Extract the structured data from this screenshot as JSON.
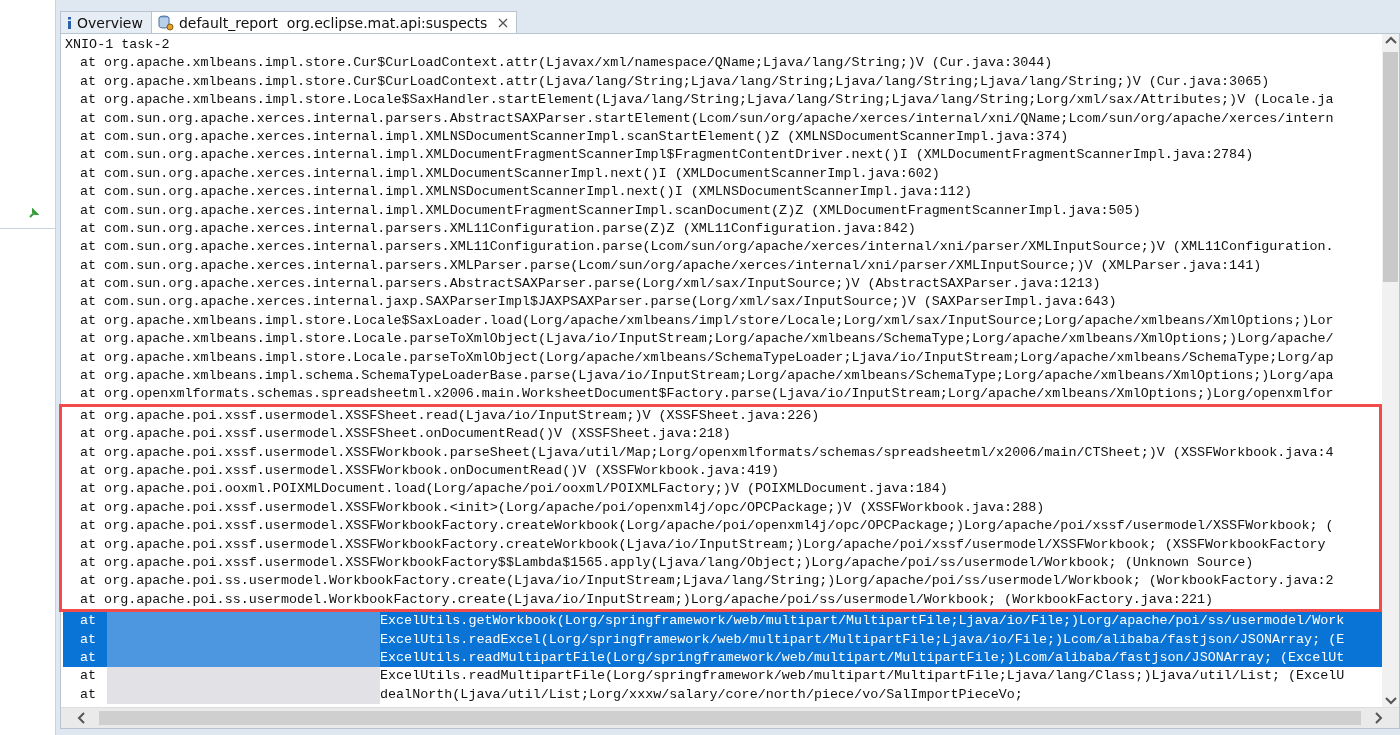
{
  "tabs": [
    {
      "kind": "info",
      "label": "Overview",
      "selected": false,
      "closable": false
    },
    {
      "kind": "report",
      "label": "default_report  org.eclipse.mat.api:suspects",
      "selected": true,
      "closable": true
    }
  ],
  "thread": "XNIO-1 task-2",
  "frames": [
    "at org.apache.xmlbeans.impl.store.Cur$CurLoadContext.attr(Ljavax/xml/namespace/QName;Ljava/lang/String;)V (Cur.java:3044)",
    "at org.apache.xmlbeans.impl.store.Cur$CurLoadContext.attr(Ljava/lang/String;Ljava/lang/String;Ljava/lang/String;Ljava/lang/String;)V (Cur.java:3065)",
    "at org.apache.xmlbeans.impl.store.Locale$SaxHandler.startElement(Ljava/lang/String;Ljava/lang/String;Ljava/lang/String;Lorg/xml/sax/Attributes;)V (Locale.ja",
    "at com.sun.org.apache.xerces.internal.parsers.AbstractSAXParser.startElement(Lcom/sun/org/apache/xerces/internal/xni/QName;Lcom/sun/org/apache/xerces/intern",
    "at com.sun.org.apache.xerces.internal.impl.XMLNSDocumentScannerImpl.scanStartElement()Z (XMLNSDocumentScannerImpl.java:374)",
    "at com.sun.org.apache.xerces.internal.impl.XMLDocumentFragmentScannerImpl$FragmentContentDriver.next()I (XMLDocumentFragmentScannerImpl.java:2784)",
    "at com.sun.org.apache.xerces.internal.impl.XMLDocumentScannerImpl.next()I (XMLDocumentScannerImpl.java:602)",
    "at com.sun.org.apache.xerces.internal.impl.XMLNSDocumentScannerImpl.next()I (XMLNSDocumentScannerImpl.java:112)",
    "at com.sun.org.apache.xerces.internal.impl.XMLDocumentFragmentScannerImpl.scanDocument(Z)Z (XMLDocumentFragmentScannerImpl.java:505)",
    "at com.sun.org.apache.xerces.internal.parsers.XML11Configuration.parse(Z)Z (XML11Configuration.java:842)",
    "at com.sun.org.apache.xerces.internal.parsers.XML11Configuration.parse(Lcom/sun/org/apache/xerces/internal/xni/parser/XMLInputSource;)V (XML11Configuration.",
    "at com.sun.org.apache.xerces.internal.parsers.XMLParser.parse(Lcom/sun/org/apache/xerces/internal/xni/parser/XMLInputSource;)V (XMLParser.java:141)",
    "at com.sun.org.apache.xerces.internal.parsers.AbstractSAXParser.parse(Lorg/xml/sax/InputSource;)V (AbstractSAXParser.java:1213)",
    "at com.sun.org.apache.xerces.internal.jaxp.SAXParserImpl$JAXPSAXParser.parse(Lorg/xml/sax/InputSource;)V (SAXParserImpl.java:643)",
    "at org.apache.xmlbeans.impl.store.Locale$SaxLoader.load(Lorg/apache/xmlbeans/impl/store/Locale;Lorg/xml/sax/InputSource;Lorg/apache/xmlbeans/XmlOptions;)Lor",
    "at org.apache.xmlbeans.impl.store.Locale.parseToXmlObject(Ljava/io/InputStream;Lorg/apache/xmlbeans/SchemaType;Lorg/apache/xmlbeans/XmlOptions;)Lorg/apache/",
    "at org.apache.xmlbeans.impl.store.Locale.parseToXmlObject(Lorg/apache/xmlbeans/SchemaTypeLoader;Ljava/io/InputStream;Lorg/apache/xmlbeans/SchemaType;Lorg/ap",
    "at org.apache.xmlbeans.impl.schema.SchemaTypeLoaderBase.parse(Ljava/io/InputStream;Lorg/apache/xmlbeans/SchemaType;Lorg/apache/xmlbeans/XmlOptions;)Lorg/apa",
    "at org.openxmlformats.schemas.spreadsheetml.x2006.main.WorksheetDocument$Factory.parse(Ljava/io/InputStream;Lorg/apache/xmlbeans/XmlOptions;)Lorg/openxmlfor"
  ],
  "highlighted_frames": [
    "at org.apache.poi.xssf.usermodel.XSSFSheet.read(Ljava/io/InputStream;)V (XSSFSheet.java:226)",
    "at org.apache.poi.xssf.usermodel.XSSFSheet.onDocumentRead()V (XSSFSheet.java:218)",
    "at org.apache.poi.xssf.usermodel.XSSFWorkbook.parseSheet(Ljava/util/Map;Lorg/openxmlformats/schemas/spreadsheetml/x2006/main/CTSheet;)V (XSSFWorkbook.java:4",
    "at org.apache.poi.xssf.usermodel.XSSFWorkbook.onDocumentRead()V (XSSFWorkbook.java:419)",
    "at org.apache.poi.ooxml.POIXMLDocument.load(Lorg/apache/poi/ooxml/POIXMLFactory;)V (POIXMLDocument.java:184)",
    "at org.apache.poi.xssf.usermodel.XSSFWorkbook.<init>(Lorg/apache/poi/openxml4j/opc/OPCPackage;)V (XSSFWorkbook.java:288)",
    "at org.apache.poi.xssf.usermodel.XSSFWorkbookFactory.createWorkbook(Lorg/apache/poi/openxml4j/opc/OPCPackage;)Lorg/apache/poi/xssf/usermodel/XSSFWorkbook; (",
    "at org.apache.poi.xssf.usermodel.XSSFWorkbookFactory.createWorkbook(Ljava/io/InputStream;)Lorg/apache/poi/xssf/usermodel/XSSFWorkbook; (XSSFWorkbookFactory",
    "at org.apache.poi.xssf.usermodel.XSSFWorkbookFactory$$Lambda$1565.apply(Ljava/lang/Object;)Lorg/apache/poi/ss/usermodel/Workbook; (Unknown Source)",
    "at org.apache.poi.ss.usermodel.WorkbookFactory.create(Ljava/io/InputStream;Ljava/lang/String;)Lorg/apache/poi/ss/usermodel/Workbook; (WorkbookFactory.java:2",
    "at org.apache.poi.ss.usermodel.WorkbookFactory.create(Ljava/io/InputStream;)Lorg/apache/poi/ss/usermodel/Workbook; (WorkbookFactory.java:221)"
  ],
  "redacted_frames": [
    {
      "prefix": "at",
      "text": "ExcelUtils.getWorkbook(Lorg/springframework/web/multipart/MultipartFile;Ljava/io/File;)Lorg/apache/poi/ss/usermodel/Work",
      "selected": true
    },
    {
      "prefix": "at",
      "text": "ExcelUtils.readExcel(Lorg/springframework/web/multipart/MultipartFile;Ljava/io/File;)Lcom/alibaba/fastjson/JSONArray; (E",
      "selected": true
    },
    {
      "prefix": "at",
      "text": "ExcelUtils.readMultipartFile(Lorg/springframework/web/multipart/MultipartFile;)Lcom/alibaba/fastjson/JSONArray; (ExcelUt",
      "selected": true
    },
    {
      "prefix": "at",
      "text": "ExcelUtils.readMultipartFile(Lorg/springframework/web/multipart/MultipartFile;Ljava/lang/Class;)Ljava/util/List; (ExcelU",
      "selected": false
    },
    {
      "prefix": "at",
      "text": "dealNorth(Ljava/util/List;Lorg/xxxw/salary/core/north/piece/vo/SalImportPieceVo;",
      "selected": false
    }
  ]
}
